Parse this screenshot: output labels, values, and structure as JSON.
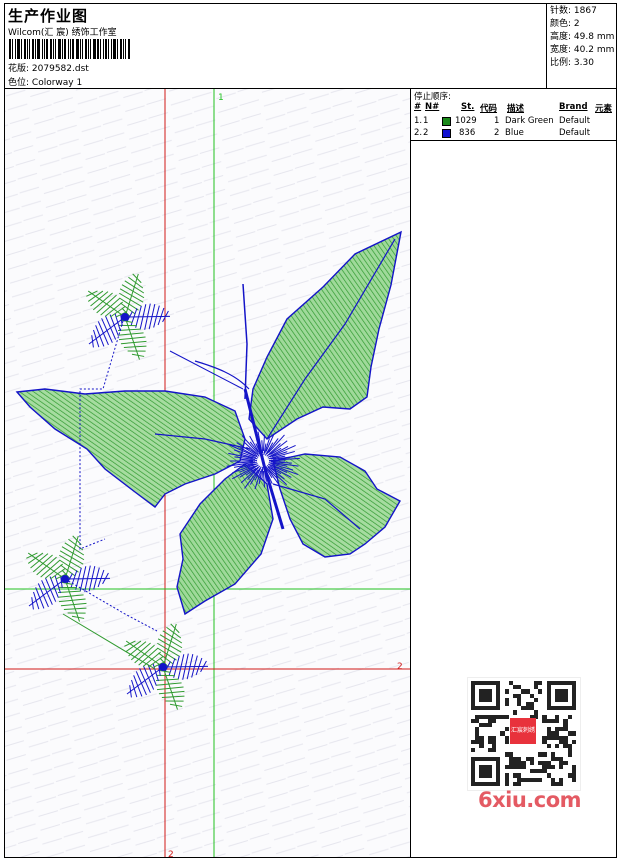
{
  "header": {
    "title": "生产作业图",
    "studio": "Wilcom(汇 宸) 绣饰工作室",
    "design_label": "花版:",
    "design_value": "2079582.dst",
    "colorway_label": "色位:",
    "colorway_value": "Colorway 1"
  },
  "stats": [
    {
      "label": "针数:",
      "value": "1867"
    },
    {
      "label": "颜色:",
      "value": "2"
    },
    {
      "label": "高度:",
      "value": "49.8 mm"
    },
    {
      "label": "宽度:",
      "value": "40.2 mm"
    },
    {
      "label": "比例:",
      "value": "3.30"
    }
  ],
  "stop_sequence": {
    "title": "停止顺序:",
    "columns": [
      "#",
      "N#",
      "St.",
      "代码",
      "描述",
      "Brand",
      "元素"
    ],
    "rows": [
      {
        "index": "1.",
        "needle": "1",
        "color": "#1a8a1a",
        "stitches": "1029",
        "code": "1",
        "description": "Dark Green",
        "brand": "Default"
      },
      {
        "index": "2.",
        "needle": "2",
        "color": "#1010d0",
        "stitches": "836",
        "code": "2",
        "description": "Blue",
        "brand": "Default"
      }
    ]
  },
  "guides": {
    "top_label": "1",
    "right_label": "2",
    "bottom_label": "2"
  },
  "colors": {
    "green": "#2f9a2f",
    "green_fill": "#8fd08a",
    "blue": "#1414c8",
    "red_guide": "#d01818",
    "green_guide": "#20c020"
  },
  "watermark": {
    "text": "6xiu.com",
    "stamp": "汇宸刺绣"
  }
}
